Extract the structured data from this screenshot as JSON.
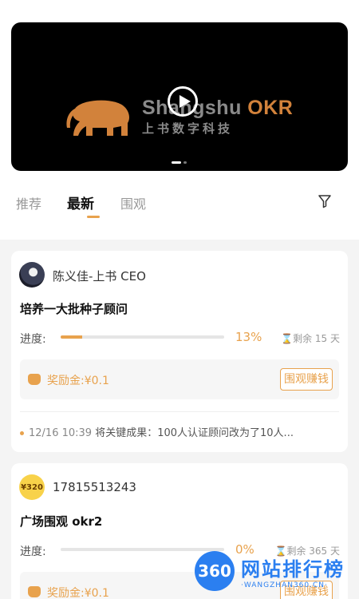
{
  "banner": {
    "logo_en_prefix": "Shangshu ",
    "logo_en_suffix": "OKR",
    "logo_cn": "上书数字科技",
    "play_icon": "play-icon",
    "carousel": {
      "current_slide": 1,
      "total_slides": 2
    }
  },
  "tabs": [
    {
      "label": "推荐",
      "active": false
    },
    {
      "label": "最新",
      "active": true
    },
    {
      "label": "围观",
      "active": false
    }
  ],
  "filter_icon": "filter-icon",
  "cards": [
    {
      "author": "陈义佳-上书 CEO",
      "title": "培养一大批种子顾问",
      "progress_label": "进度:",
      "progress_percent": 13,
      "progress_text": "13%",
      "remaining": "剩余 15 天",
      "reward": "奖励金:¥0.1",
      "watch_button": "围观赚钱",
      "log_time": "12/16 10:39",
      "log_text": "将关键成果：100人认证顾问改为了10人..."
    },
    {
      "avatar_text": "¥320",
      "author": "17815513243",
      "title": "广场围观 okr2",
      "progress_label": "进度:",
      "progress_percent": 0,
      "progress_text": "0%",
      "remaining": "剩余 365 天",
      "reward": "奖励金:¥0.1",
      "watch_button": "围观赚钱"
    }
  ],
  "watermark": {
    "badge": "360",
    "cn": "网站排行榜",
    "en": "·WANGZHAN360.CN·"
  },
  "colors": {
    "accent": "#e8a24d",
    "watermark": "#2b7ff0"
  }
}
